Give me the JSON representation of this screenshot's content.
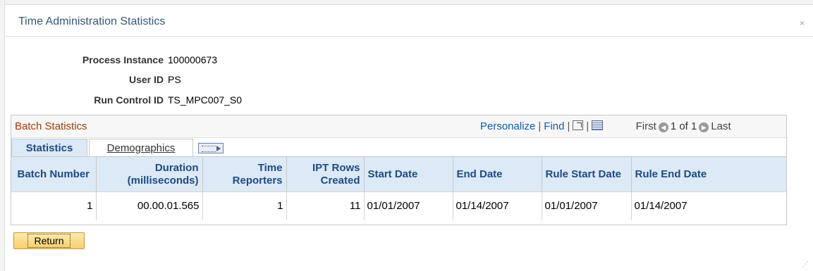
{
  "window": {
    "title": "Time Administration Statistics",
    "close_glyph": "×"
  },
  "info": [
    {
      "label": "Process Instance",
      "value": "100000673"
    },
    {
      "label": "User ID",
      "value": "PS"
    },
    {
      "label": "Run Control ID",
      "value": "TS_MPC007_S0"
    }
  ],
  "grid": {
    "title": "Batch Statistics",
    "personalize": "Personalize",
    "find": "Find",
    "first": "First",
    "range": "1 of 1",
    "last": "Last",
    "tabs": [
      {
        "label": "Statistics",
        "active": true
      },
      {
        "label": "Demographics",
        "active": false
      }
    ],
    "columns": [
      "Batch Number",
      "Duration (milliseconds)",
      "Time Reporters",
      "IPT Rows Created",
      "Start Date",
      "End Date",
      "Rule Start Date",
      "Rule End Date"
    ],
    "rows": [
      [
        "1",
        "00.00.01.565",
        "1",
        "11",
        "01/01/2007",
        "01/14/2007",
        "01/01/2007",
        "01/14/2007"
      ]
    ]
  },
  "actions": {
    "return_label": "Return"
  },
  "colors": {
    "title": "#37577a",
    "grid_title": "#a63b06",
    "link": "#0d5bb5",
    "header_bg": "#dce9f6",
    "header_text": "#1e4a82",
    "button": "#f6cf69"
  }
}
